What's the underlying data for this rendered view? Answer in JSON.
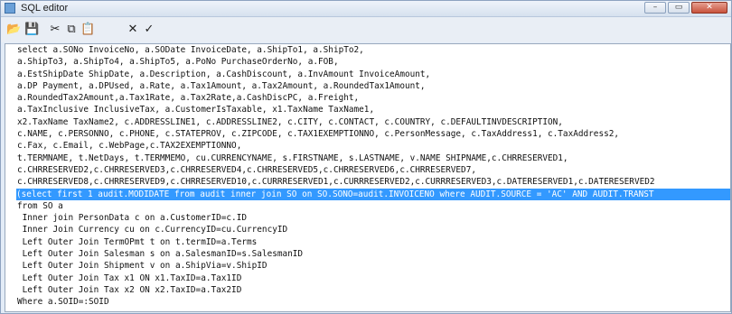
{
  "window": {
    "title": "SQL editor"
  },
  "titlebar_buttons": {
    "minimize": "–",
    "restore": "▭",
    "close": "✕"
  },
  "toolbar": {
    "open_icon": "📂",
    "save_icon": "💾",
    "cut_icon": "✂",
    "copy_icon": "⧉",
    "paste_icon": "📋",
    "cancel_icon": "✕",
    "ok_icon": "✓"
  },
  "editor": {
    "lines": [
      "select a.SONo InvoiceNo, a.SODate InvoiceDate, a.ShipTo1, a.ShipTo2,",
      "a.ShipTo3, a.ShipTo4, a.ShipTo5, a.PoNo PurchaseOrderNo, a.FOB,",
      "a.EstShipDate ShipDate, a.Description, a.CashDiscount, a.InvAmount InvoiceAmount,",
      "a.DP Payment, a.DPUsed, a.Rate, a.Tax1Amount, a.Tax2Amount, a.RoundedTax1Amount,",
      "a.RoundedTax2Amount,a.Tax1Rate, a.Tax2Rate,a.CashDiscPC, a.Freight,",
      "a.TaxInclusive InclusiveTax, a.CustomerIsTaxable, x1.TaxName TaxName1,",
      "x2.TaxName TaxName2, c.ADDRESSLINE1, c.ADDRESSLINE2, c.CITY, c.CONTACT, c.COUNTRY, c.DEFAULTINVDESCRIPTION,",
      "c.NAME, c.PERSONNO, c.PHONE, c.STATEPROV, c.ZIPCODE, c.TAX1EXEMPTIONNO, c.PersonMessage, c.TaxAddress1, c.TaxAddress2,",
      "c.Fax, c.Email, c.WebPage,c.TAX2EXEMPTIONNO,",
      "t.TERMNAME, t.NetDays, t.TERMMEMO, cu.CURRENCYNAME, s.FIRSTNAME, s.LASTNAME, v.NAME SHIPNAME,c.CHRRESERVED1,",
      "c.CHRRESERVED2,c.CHRRESERVED3,c.CHRRESERVED4,c.CHRRESERVED5,c.CHRRESERVED6,c.CHRRESERVED7,",
      "c.CHRRESERVED8,c.CHRRESERVED9,c.CHRRESERVED10,c.CURRRESERVED1,c.CURRRESERVED2,c.CURRRESERVED3,c.DATERESERVED1,c.DATERESERVED2",
      "(select first 1 audit.MODIDATE from audit inner join SO on SO.SONO=audit.INVOICENO where AUDIT.SOURCE = 'AC' AND AUDIT.TRANST",
      "from SO a",
      " Inner join PersonData c on a.CustomerID=c.ID",
      " Inner Join Currency cu on c.CurrencyID=cu.CurrencyID",
      " Left Outer Join TermOPmt t on t.termID=a.Terms",
      " Left Outer Join Salesman s on a.SalesmanID=s.SalesmanID",
      " Left Outer Join Shipment v on a.ShipVia=v.ShipID",
      " Left Outer Join Tax x1 ON x1.TaxID=a.Tax1ID",
      " Left Outer Join Tax x2 ON x2.TaxID=a.Tax2ID",
      "Where a.SOID=:SOID"
    ],
    "selected_line_index": 12
  }
}
